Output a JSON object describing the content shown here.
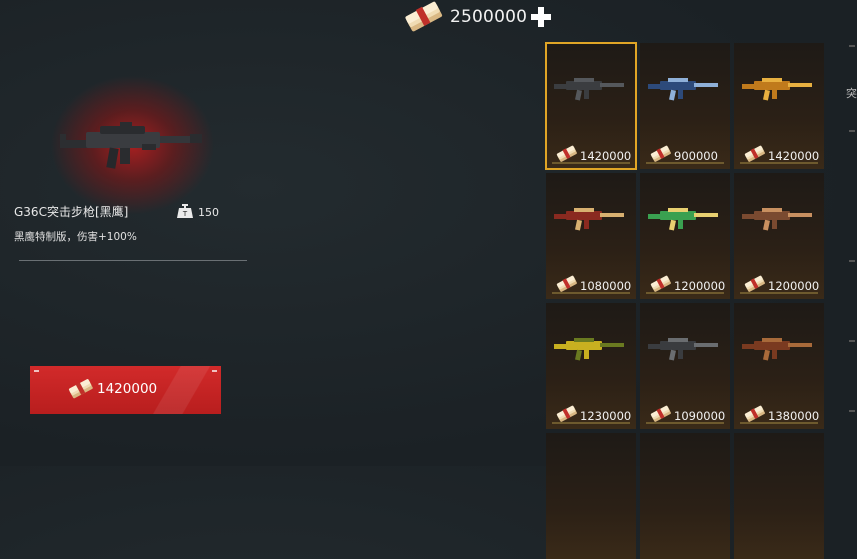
{
  "header": {
    "currency_amount": "2500000",
    "add_icon": "plus-icon",
    "currency_icon": "cash-stack-icon"
  },
  "preview": {
    "weapon_name": "G36C突击步枪[黑鹰]",
    "weight_icon": "weight-icon",
    "weight_value": "150",
    "description": "黑鹰特制版，伤害+100%",
    "buy_price": "1420000"
  },
  "store": {
    "items": [
      {
        "price": "1420000",
        "selected": true,
        "body": "#3b3d40",
        "accent": "#55585c"
      },
      {
        "price": "900000",
        "selected": false,
        "body": "#2d4a7a",
        "accent": "#8fb0d8"
      },
      {
        "price": "1420000",
        "selected": false,
        "body": "#c07a1c",
        "accent": "#e8b040"
      },
      {
        "price": "1080000",
        "selected": false,
        "body": "#8a2a20",
        "accent": "#d8b070"
      },
      {
        "price": "1200000",
        "selected": false,
        "body": "#3aa050",
        "accent": "#e8d070"
      },
      {
        "price": "1200000",
        "selected": false,
        "body": "#7a4a30",
        "accent": "#c89060"
      },
      {
        "price": "1230000",
        "selected": false,
        "body": "#c8b020",
        "accent": "#6a7a20"
      },
      {
        "price": "1090000",
        "selected": false,
        "body": "#3a3c3f",
        "accent": "#6a6d70"
      },
      {
        "price": "1380000",
        "selected": false,
        "body": "#7a3a20",
        "accent": "#a86a3a"
      },
      {
        "price": "",
        "selected": false,
        "body": "",
        "accent": ""
      },
      {
        "price": "",
        "selected": false,
        "body": "",
        "accent": ""
      },
      {
        "price": "",
        "selected": false,
        "body": "",
        "accent": ""
      }
    ]
  },
  "sidebar": {
    "partial_label": "突"
  },
  "colors": {
    "selected_border": "#e0a526",
    "buy_button": "#c82424"
  }
}
